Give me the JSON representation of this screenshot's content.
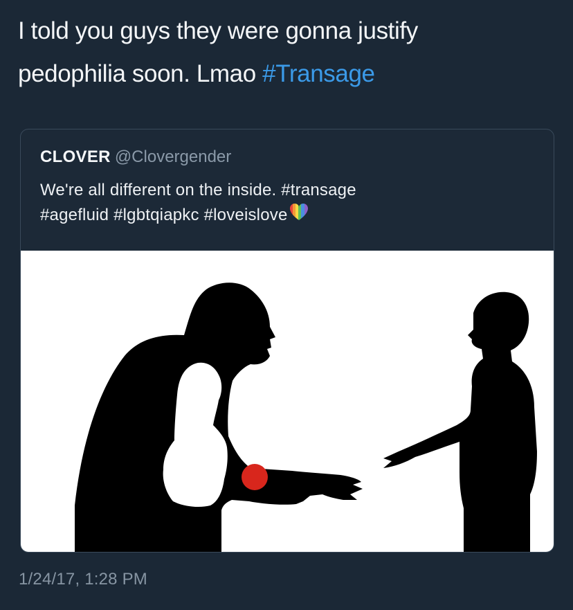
{
  "tweet": {
    "text_line1": "I told you guys they were gonna justify",
    "text_line2_prefix": "pedophilia soon. Lmao ",
    "text_hashtag": "#Transage",
    "timestamp": "1/24/17, 1:28 PM"
  },
  "quoted_tweet": {
    "display_name": "CLOVER",
    "handle": "@Clovergender",
    "text_line1": "We're all different on the inside. #transage",
    "text_line2": "#agefluid #lgbtqiapkc #loveislove",
    "emoji": "rainbow-heart-icon"
  },
  "colors": {
    "background": "#1b2836",
    "hashtag_link": "#3b9ae8",
    "secondary_text": "#8795a3",
    "image_background": "#ffffff",
    "red_marker": "#d8261c"
  }
}
